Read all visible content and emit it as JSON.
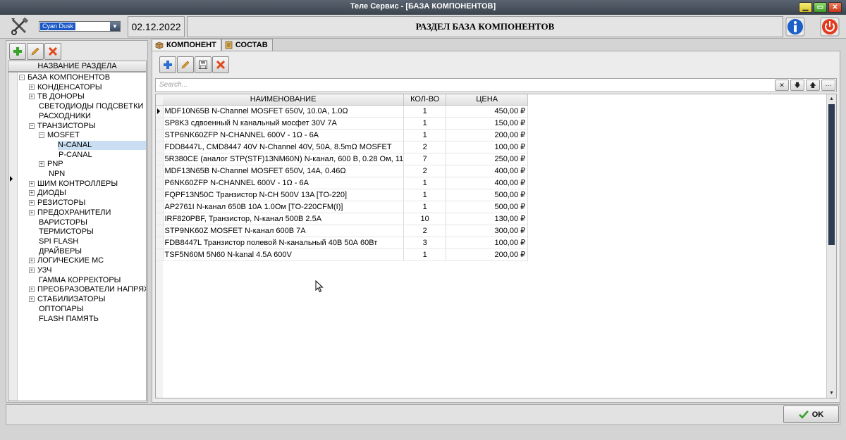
{
  "window": {
    "title": "Теле Сервис - [БАЗА КОМПОНЕНТОВ]"
  },
  "header": {
    "theme_value": "Cyan Dusk",
    "date": "02.12.2022",
    "section_title": "РАЗДЕЛ БАЗА КОМПОНЕНТОВ"
  },
  "left": {
    "tree_header": "НАЗВАНИЕ РАЗДЕЛА",
    "nodes": [
      {
        "label": "БАЗА КОМПОНЕНТОВ",
        "exp": "−"
      },
      {
        "label": "КОНДЕНСАТОРЫ",
        "exp": "+"
      },
      {
        "label": "ТВ ДОНОРЫ",
        "exp": "+"
      },
      {
        "label": "СВЕТОДИОДЫ ПОДСВЕТКИ",
        "exp": ""
      },
      {
        "label": "РАСХОДНИКИ",
        "exp": ""
      },
      {
        "label": "ТРАНЗИСТОРЫ",
        "exp": "−"
      },
      {
        "label": "MOSFET",
        "exp": "−"
      },
      {
        "label": "N-CANAL",
        "exp": ""
      },
      {
        "label": "P-CANAL",
        "exp": ""
      },
      {
        "label": "PNP",
        "exp": "+"
      },
      {
        "label": "NPN",
        "exp": ""
      },
      {
        "label": "ШИМ КОНТРОЛЛЕРЫ",
        "exp": "+"
      },
      {
        "label": "ДИОДЫ",
        "exp": "+"
      },
      {
        "label": "РЕЗИСТОРЫ",
        "exp": "+"
      },
      {
        "label": "ПРЕДОХРАНИТЕЛИ",
        "exp": "+"
      },
      {
        "label": "ВАРИСТОРЫ",
        "exp": ""
      },
      {
        "label": "ТЕРМИСТОРЫ",
        "exp": ""
      },
      {
        "label": "SPI FLASH",
        "exp": ""
      },
      {
        "label": "ДРАЙВЕРЫ",
        "exp": ""
      },
      {
        "label": "ЛОГИЧЕСКИЕ МС",
        "exp": "+"
      },
      {
        "label": "УЗЧ",
        "exp": "+"
      },
      {
        "label": "ГАММА КОРРЕКТОРЫ",
        "exp": ""
      },
      {
        "label": "ПРЕОБРАЗОВАТЕЛИ НАПРЯЖ",
        "exp": "+"
      },
      {
        "label": "СТАБИЛИЗАТОРЫ",
        "exp": "+"
      },
      {
        "label": "ОПТОПАРЫ",
        "exp": ""
      },
      {
        "label": "FLASH ПАМЯТЬ",
        "exp": ""
      }
    ]
  },
  "tabs": [
    {
      "label": "КОМПОНЕНТ"
    },
    {
      "label": "СОСТАВ"
    }
  ],
  "search": {
    "placeholder": "Search..."
  },
  "table": {
    "columns": [
      "НАИМЕНОВАНИЕ",
      "КОЛ-ВО",
      "ЦЕНА"
    ],
    "rows": [
      {
        "name": "MDF10N65B N-Channel MOSFET  650V, 10.0A, 1.0Ω",
        "qty": "1",
        "price": "450,00 ₽"
      },
      {
        "name": "SP8K3 сдвоенный N канальный мосфет 30V 7A",
        "qty": "1",
        "price": "150,00 ₽"
      },
      {
        "name": "STP6NK60ZFP N-CHANNEL 600V - 1Ω - 6A",
        "qty": "1",
        "price": "200,00 ₽"
      },
      {
        "name": "FDD8447L, CMD8447 40V N-Channel 40V, 50A, 8.5mΩ MOSFET",
        "qty": "2",
        "price": "100,00 ₽"
      },
      {
        "name": "5R380CE (аналог STP(STF)13NM60N) N-канал, 600 В, 0.28 Ом, 11",
        "qty": "7",
        "price": "250,00 ₽"
      },
      {
        "name": "MDF13N65B N-Channel MOSFET 650V, 14A, 0.46Ω",
        "qty": "2",
        "price": "400,00 ₽"
      },
      {
        "name": "P6NK60ZFP N-CHANNEL 600V - 1Ω - 6A",
        "qty": "1",
        "price": "400,00 ₽"
      },
      {
        "name": "FQPF13N50C Транзистор N-CH 500V 13A [TO-220]",
        "qty": "1",
        "price": "500,00 ₽"
      },
      {
        "name": "AP2761I N-канал 650В 10А 1.0Ом [TO-220CFM(I)]",
        "qty": "1",
        "price": "500,00 ₽"
      },
      {
        "name": "IRF820PBF, Транзистор, N-канал 500В 2.5А",
        "qty": "10",
        "price": "130,00 ₽"
      },
      {
        "name": "STP9NK60Z MOSFET N-канал 600В 7А",
        "qty": "2",
        "price": "300,00 ₽"
      },
      {
        "name": "FDB8447L Транзистор полевой N-канальный 40В 50А 60Вт",
        "qty": "3",
        "price": "100,00 ₽"
      },
      {
        "name": "TSF5N60M 5N60 N-kanal 4.5A 600V",
        "qty": "1",
        "price": "200,00 ₽"
      }
    ]
  },
  "footer": {
    "ok_label": "OK"
  },
  "colors": {
    "selection": "#c9ddf3",
    "scroll_thumb": "#2d3b53",
    "accent_blue": "#1a56c6"
  }
}
